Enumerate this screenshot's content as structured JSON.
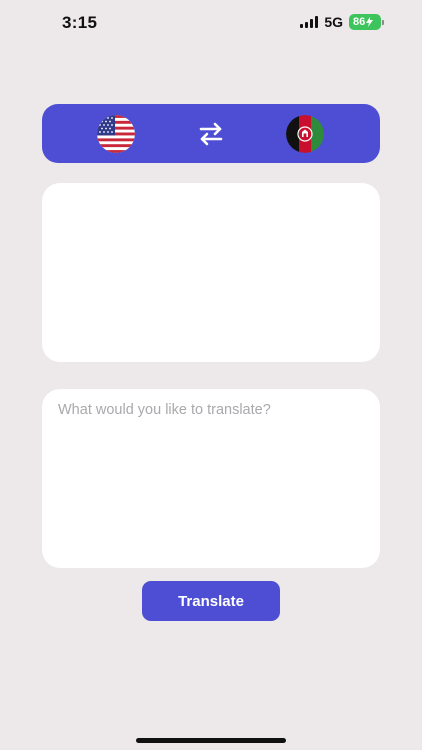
{
  "status_bar": {
    "time": "3:15",
    "network": "5G",
    "battery": "86",
    "battery_charging_icon": "bolt-icon"
  },
  "language_bar": {
    "source_flag_icon": "us-flag-icon",
    "swap_icon": "swap-arrows-icon",
    "target_flag_icon": "afghanistan-flag-icon"
  },
  "output": {
    "text": ""
  },
  "input": {
    "value": "",
    "placeholder": "What would you like to translate?"
  },
  "translate_button": {
    "label": "Translate"
  },
  "colors": {
    "background": "#ede8e9",
    "accent": "#4d4ed4",
    "battery": "#3ec45c",
    "card": "#ffffff",
    "placeholder": "#a9a9ad"
  }
}
